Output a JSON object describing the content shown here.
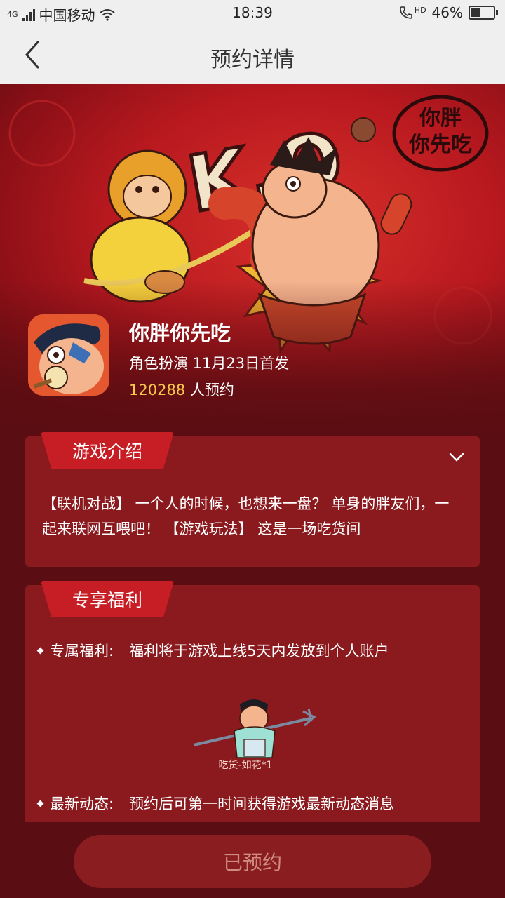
{
  "status_bar": {
    "network": "4G",
    "carrier": "中国移动",
    "time": "18:39",
    "call_badge": "HD",
    "battery": "46%",
    "battery_level": 0.46
  },
  "nav": {
    "title": "预约详情"
  },
  "banner": {
    "brand_text": "你胖你先吃",
    "ko_text": "K.O"
  },
  "app": {
    "name": "你胖你先吃",
    "meta": "角色扮演 11月23日首发",
    "reservations": "120288",
    "reservations_suffix": " 人预约"
  },
  "intro": {
    "tag": "游戏介绍",
    "text": "【联机对战】 一个人的时候，也想来一盘？ 单身的胖友们，一起来联网互喂吧！ 【游戏玩法】 这是一场吃货间"
  },
  "benefits": {
    "tag": "专享福利",
    "items": [
      {
        "key": "专属福利:",
        "value": "福利将于游戏上线5天内发放到个人账户"
      },
      {
        "key": "最新动态:",
        "value": "预约后可第一时间获得游戏最新动态消息"
      }
    ],
    "reward_label": "吃货-如花*1"
  },
  "bottom": {
    "reserve_label": "已预约"
  },
  "colors": {
    "page_bg": "#5a0d12",
    "card_bg": "#8a1a1e",
    "tag_bg": "#c61e24",
    "count_color": "#f7c74a"
  }
}
